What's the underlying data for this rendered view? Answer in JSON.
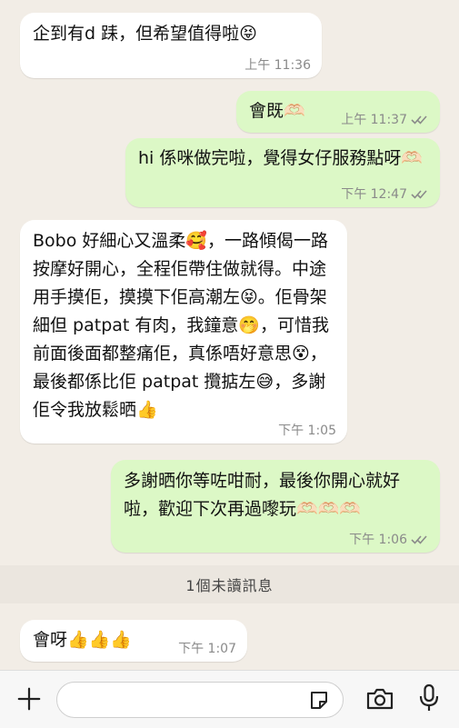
{
  "messages": [
    {
      "direction": "incoming",
      "text": "企到有d 𨀤，但希望值得啦😝",
      "time": "上午 11:36"
    },
    {
      "direction": "outgoing",
      "text": "會既🫶🏻",
      "time": "上午 11:37",
      "status": "read"
    },
    {
      "direction": "outgoing",
      "text": "hi 係咪做完啦，覺得女仔服務點呀🫶🏻",
      "time": "下午 12:47",
      "status": "read"
    },
    {
      "direction": "incoming",
      "text": "Bobo 好細心又溫柔🥰，一路傾偈一路按摩好開心，全程佢帶住做就得。中途用手摸佢，摸摸下佢高潮左😝。佢骨架細但 patpat 有肉，我鐘意🤭，可惜我前面後面都整痛佢，真係唔好意思😵，最後都係比佢 patpat 攬掂左😅，多謝佢令我放鬆晒👍",
      "time": "下午 1:05"
    },
    {
      "direction": "outgoing",
      "text": "多謝晒你等咗咁耐，最後你開心就好啦，歡迎下次再過嚟玩🫶🏻🫶🏻🫶🏻",
      "time": "下午 1:06",
      "status": "read"
    },
    {
      "direction": "incoming",
      "text": "會呀👍👍👍",
      "time": "下午 1:07"
    }
  ],
  "unread_divider": "1個未讀訊息",
  "composer": {
    "placeholder": ""
  },
  "colors": {
    "incoming_bubble": "#ffffff",
    "outgoing_bubble": "#dcf8c6",
    "background": "#f2ede6"
  },
  "icons": {
    "add": "plus-icon",
    "sticker": "sticker-icon",
    "camera": "camera-icon",
    "mic": "microphone-icon",
    "read": "double-check-icon"
  }
}
